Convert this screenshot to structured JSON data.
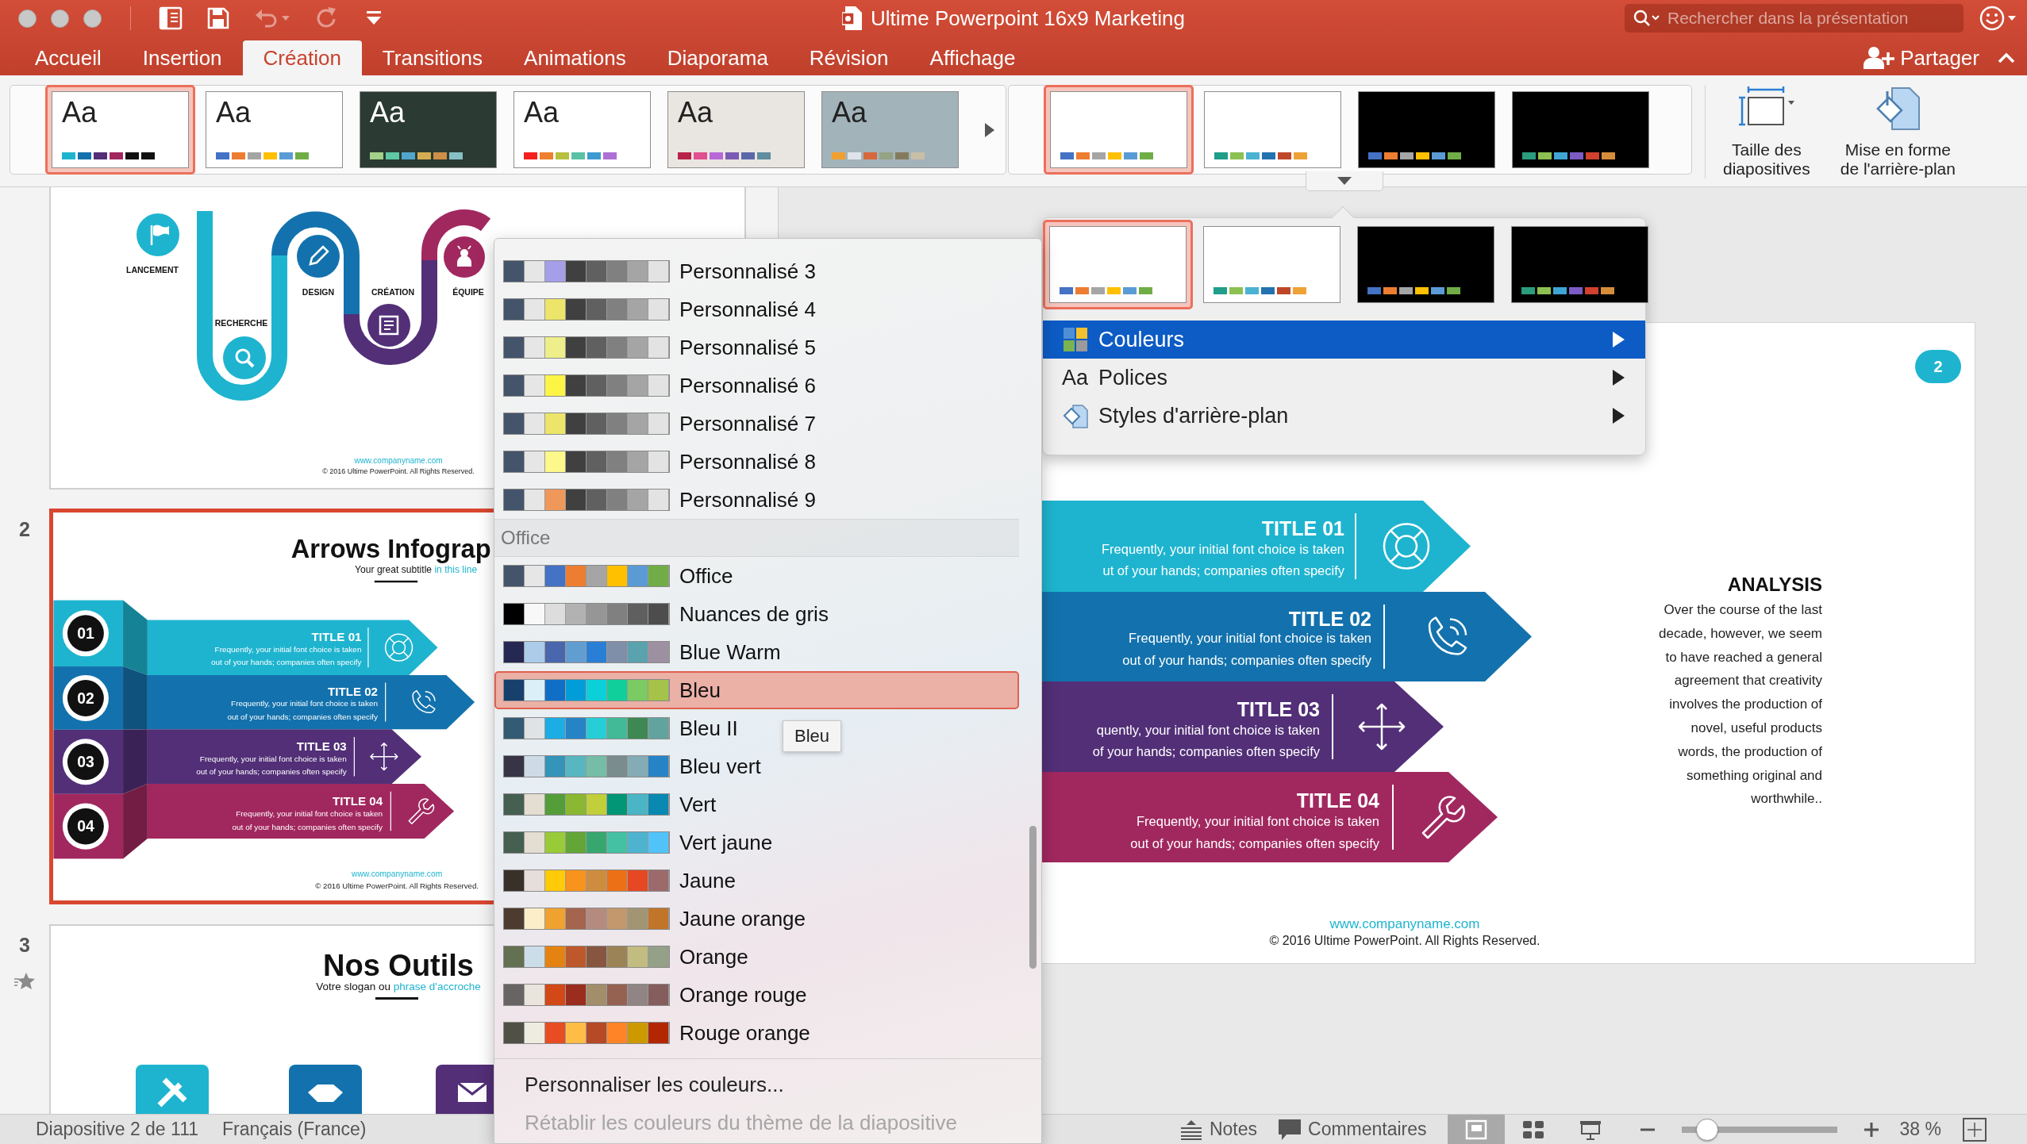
{
  "window": {
    "title": "Ultime Powerpoint 16x9 Marketing"
  },
  "quick_access": [
    {
      "kind": "sidebar",
      "disabled": false
    },
    {
      "kind": "save",
      "disabled": false
    },
    {
      "kind": "undo",
      "disabled": true
    },
    {
      "kind": "redo",
      "disabled": true
    },
    {
      "kind": "customize",
      "disabled": false
    }
  ],
  "search": {
    "placeholder": "Rechercher dans la présentation"
  },
  "tabs": [
    {
      "label": "Accueil",
      "selected": false
    },
    {
      "label": "Insertion",
      "selected": false
    },
    {
      "label": "Création",
      "selected": true
    },
    {
      "label": "Transitions",
      "selected": false
    },
    {
      "label": "Animations",
      "selected": false
    },
    {
      "label": "Diaporama",
      "selected": false
    },
    {
      "label": "Révision",
      "selected": false
    },
    {
      "label": "Affichage",
      "selected": false
    }
  ],
  "share_button": {
    "label": "Partager"
  },
  "ribbon": {
    "themes": [
      {
        "label": "Aa",
        "selected": true,
        "color": "#ffffff",
        "swatches": [
          {
            "color": "#1eb4cf"
          },
          {
            "color": "#1372ad"
          },
          {
            "color": "#522f77"
          },
          {
            "color": "#a1285f"
          },
          {
            "color": "#111111"
          },
          {
            "color": "#111111"
          }
        ]
      },
      {
        "label": "Aa",
        "selected": false,
        "color": "#ffffff",
        "swatches": [
          {
            "color": "#4472c4"
          },
          {
            "color": "#ed7d31"
          },
          {
            "color": "#a5a5a5"
          },
          {
            "color": "#ffc000"
          },
          {
            "color": "#5b9bd5"
          },
          {
            "color": "#70ad47"
          }
        ]
      },
      {
        "label": "Aa",
        "selected": false,
        "color": "#2b3a33",
        "swatches": [
          {
            "color": "#a3d18a"
          },
          {
            "color": "#5ec9a4"
          },
          {
            "color": "#50a7c9"
          },
          {
            "color": "#d4ad52"
          },
          {
            "color": "#cf8f47"
          },
          {
            "color": "#86c0c3"
          }
        ]
      },
      {
        "label": "Aa",
        "selected": false,
        "color": "#ffffff",
        "swatches": [
          {
            "color": "#f4211f"
          },
          {
            "color": "#f07f2e"
          },
          {
            "color": "#b8c03e"
          },
          {
            "color": "#5bc1a5"
          },
          {
            "color": "#3e9bd1"
          },
          {
            "color": "#ae6fd6"
          }
        ]
      },
      {
        "label": "Aa",
        "selected": false,
        "color": "#e9e6e1",
        "swatches": [
          {
            "color": "#b7234a"
          },
          {
            "color": "#e04f8f"
          },
          {
            "color": "#b868d6"
          },
          {
            "color": "#7a5bb3"
          },
          {
            "color": "#5a67a8"
          },
          {
            "color": "#5f8e9e"
          }
        ]
      },
      {
        "label": "Aa",
        "selected": false,
        "color": "#a3b3ba",
        "swatches": [
          {
            "color": "#f0a030"
          },
          {
            "color": "#dfe4ea"
          },
          {
            "color": "#d6683b"
          },
          {
            "color": "#93a383"
          },
          {
            "color": "#857b5c"
          },
          {
            "color": "#c9bfa6"
          }
        ]
      }
    ],
    "variants": [
      {
        "selected": true,
        "color": "#ffffff",
        "swatches": [
          {
            "color": "#4472c4"
          },
          {
            "color": "#ed7d31"
          },
          {
            "color": "#a5a5a5"
          },
          {
            "color": "#ffc000"
          },
          {
            "color": "#5b9bd5"
          },
          {
            "color": "#70ad47"
          }
        ]
      },
      {
        "selected": false,
        "color": "#ffffff",
        "swatches": [
          {
            "color": "#1f9e89"
          },
          {
            "color": "#8cc152"
          },
          {
            "color": "#4ab3d1"
          },
          {
            "color": "#2272b0"
          },
          {
            "color": "#c0462a"
          },
          {
            "color": "#eea236"
          }
        ]
      },
      {
        "selected": false,
        "color": "#000000",
        "swatches": [
          {
            "color": "#4472c4"
          },
          {
            "color": "#ed7d31"
          },
          {
            "color": "#a5a5a5"
          },
          {
            "color": "#ffc000"
          },
          {
            "color": "#5b9bd5"
          },
          {
            "color": "#70ad47"
          }
        ]
      },
      {
        "selected": false,
        "color": "#000000",
        "swatches": [
          {
            "color": "#2a9d7e"
          },
          {
            "color": "#8cc152"
          },
          {
            "color": "#3fa5d4"
          },
          {
            "color": "#7c5cc4"
          },
          {
            "color": "#d0412e"
          },
          {
            "color": "#d58d3a"
          }
        ]
      }
    ],
    "buttons": [
      {
        "kind": "slide-size",
        "lines": [
          "Taille des",
          "diapositives"
        ]
      },
      {
        "kind": "background-format",
        "lines": [
          "Mise en forme",
          "de l'arrière-plan"
        ]
      }
    ]
  },
  "thumbnails": [
    {
      "kind": "road",
      "selected": false,
      "steps": [
        {
          "label": "LANCEMENT",
          "color": "#1eb4cf"
        },
        {
          "label": "RECHERCHE",
          "color": "#1eb4cf"
        },
        {
          "label": "DESIGN",
          "color": "#1372ad"
        },
        {
          "label": "CRÉATION",
          "color": "#522f77"
        },
        {
          "label": "ÉQUIPE",
          "color": "#a1285f"
        }
      ],
      "link": "www.companyname.com",
      "copyright": "© 2016 Ultime PowerPoint. All Rights Reserved."
    },
    {
      "kind": "arrows",
      "number": "2",
      "selected": true,
      "title": "Arrows Infograp",
      "subtitle": "Your great subtitle",
      "subtitle_accent": "in this line",
      "arrows": [
        {
          "number": "01",
          "title": "TITLE 01",
          "lines": [
            "Frequently, your initial font choice is taken",
            "out of your hands; companies often specify"
          ],
          "color": "#1eb4cf"
        },
        {
          "number": "02",
          "title": "TITLE 02",
          "lines": [
            "Frequently, your initial font choice is taken",
            "out of your hands; companies often specify"
          ],
          "color": "#1372ad"
        },
        {
          "number": "03",
          "title": "TITLE 03",
          "lines": [
            "Frequently, your initial font choice is taken",
            "out of your hands; companies often specify"
          ],
          "color": "#522f77"
        },
        {
          "number": "04",
          "title": "TITLE 04",
          "lines": [
            "Frequently, your initial font choice is taken",
            "out of your hands; companies often specify"
          ],
          "color": "#a1285f"
        }
      ],
      "link": "www.companyname.com",
      "copyright": "© 2016 Ultime PowerPoint. All Rights Reserved."
    },
    {
      "kind": "tools",
      "number": "3",
      "selected": false,
      "animated": true,
      "title": "Nos Outils",
      "subtitle": "Votre slogan ou",
      "subtitle_accent": "phrase d'accroche",
      "tiles": [
        {
          "color": "#1eb4cf"
        },
        {
          "color": "#1372ad"
        },
        {
          "color": "#522f77"
        }
      ]
    }
  ],
  "main_slide": {
    "number": "2",
    "arrows": [
      {
        "title": "TITLE 01",
        "lines": [
          "Frequently, your initial font choice is taken",
          "ut of your hands; companies often specify"
        ],
        "color": "#1eb4cf"
      },
      {
        "title": "TITLE 02",
        "lines": [
          "Frequently, your initial font choice is taken",
          "out of your hands; companies often specify"
        ],
        "color": "#1372ad"
      },
      {
        "title": "TITLE 03",
        "lines": [
          "quently, your initial font choice is taken",
          "of your hands; companies often specify"
        ],
        "color": "#522f77"
      },
      {
        "title": "TITLE 04",
        "lines": [
          "Frequently, your initial font choice is taken",
          "out of your hands; companies often specify"
        ],
        "color": "#a1285f"
      }
    ],
    "analysis": {
      "title": "ANALYSIS",
      "lines": [
        "Over the course of the last",
        "decade, however, we seem",
        "to have reached a general",
        "agreement that creativity",
        "involves the production of",
        "novel, useful products",
        "words, the production of",
        "something original and",
        "worthwhile.."
      ]
    },
    "link": "www.companyname.com",
    "copyright": "© 2016 Ultime PowerPoint. All Rights Reserved."
  },
  "design_menu": {
    "variants": [
      {
        "selected": true,
        "color": "#ffffff",
        "swatches": [
          {
            "color": "#4472c4"
          },
          {
            "color": "#ed7d31"
          },
          {
            "color": "#a5a5a5"
          },
          {
            "color": "#ffc000"
          },
          {
            "color": "#5b9bd5"
          },
          {
            "color": "#70ad47"
          }
        ]
      },
      {
        "selected": false,
        "color": "#ffffff",
        "swatches": [
          {
            "color": "#1f9e89"
          },
          {
            "color": "#8cc152"
          },
          {
            "color": "#4ab3d1"
          },
          {
            "color": "#2272b0"
          },
          {
            "color": "#c0462a"
          },
          {
            "color": "#eea236"
          }
        ]
      },
      {
        "selected": false,
        "color": "#000000",
        "swatches": [
          {
            "color": "#4472c4"
          },
          {
            "color": "#ed7d31"
          },
          {
            "color": "#a5a5a5"
          },
          {
            "color": "#ffc000"
          },
          {
            "color": "#5b9bd5"
          },
          {
            "color": "#70ad47"
          }
        ]
      },
      {
        "selected": false,
        "color": "#000000",
        "swatches": [
          {
            "color": "#2a9d7e"
          },
          {
            "color": "#8cc152"
          },
          {
            "color": "#3fa5d4"
          },
          {
            "color": "#7c5cc4"
          },
          {
            "color": "#d0412e"
          },
          {
            "color": "#d58d3a"
          }
        ]
      }
    ],
    "items": [
      {
        "kind": "colors",
        "label": "Couleurs",
        "selected": true
      },
      {
        "kind": "fonts",
        "icon_label": "Aa",
        "label": "Polices",
        "selected": false
      },
      {
        "kind": "background",
        "label": "Styles d'arrière-plan",
        "selected": false
      }
    ]
  },
  "color_menu": {
    "custom_items": [
      {
        "label": "Personnalisé 3",
        "selected": false,
        "swatches": [
          {
            "color": "#44546a"
          },
          {
            "color": "#e7e6e6"
          },
          {
            "color": "#a59ee8"
          },
          {
            "color": "#404040"
          },
          {
            "color": "#606060"
          },
          {
            "color": "#808080"
          },
          {
            "color": "#a5a5a5"
          },
          {
            "color": "#e3e3e3"
          }
        ]
      },
      {
        "label": "Personnalisé 4",
        "selected": false,
        "swatches": [
          {
            "color": "#44546a"
          },
          {
            "color": "#e7e6e6"
          },
          {
            "color": "#ede56a"
          },
          {
            "color": "#404040"
          },
          {
            "color": "#606060"
          },
          {
            "color": "#808080"
          },
          {
            "color": "#a5a5a5"
          },
          {
            "color": "#e3e3e3"
          }
        ]
      },
      {
        "label": "Personnalisé 5",
        "selected": false,
        "swatches": [
          {
            "color": "#44546a"
          },
          {
            "color": "#e7e6e6"
          },
          {
            "color": "#eeee8a"
          },
          {
            "color": "#404040"
          },
          {
            "color": "#606060"
          },
          {
            "color": "#808080"
          },
          {
            "color": "#a5a5a5"
          },
          {
            "color": "#e3e3e3"
          }
        ]
      },
      {
        "label": "Personnalisé 6",
        "selected": false,
        "swatches": [
          {
            "color": "#44546a"
          },
          {
            "color": "#e7e6e6"
          },
          {
            "color": "#fdf545"
          },
          {
            "color": "#404040"
          },
          {
            "color": "#606060"
          },
          {
            "color": "#808080"
          },
          {
            "color": "#a5a5a5"
          },
          {
            "color": "#e3e3e3"
          }
        ]
      },
      {
        "label": "Personnalisé 7",
        "selected": false,
        "swatches": [
          {
            "color": "#44546a"
          },
          {
            "color": "#e7e6e6"
          },
          {
            "color": "#ede56a"
          },
          {
            "color": "#404040"
          },
          {
            "color": "#606060"
          },
          {
            "color": "#808080"
          },
          {
            "color": "#a5a5a5"
          },
          {
            "color": "#e3e3e3"
          }
        ]
      },
      {
        "label": "Personnalisé 8",
        "selected": false,
        "swatches": [
          {
            "color": "#44546a"
          },
          {
            "color": "#e7e6e6"
          },
          {
            "color": "#fdf88a"
          },
          {
            "color": "#404040"
          },
          {
            "color": "#606060"
          },
          {
            "color": "#808080"
          },
          {
            "color": "#a5a5a5"
          },
          {
            "color": "#e3e3e3"
          }
        ]
      },
      {
        "label": "Personnalisé 9",
        "selected": false,
        "swatches": [
          {
            "color": "#44546a"
          },
          {
            "color": "#e7e6e6"
          },
          {
            "color": "#f0985a"
          },
          {
            "color": "#404040"
          },
          {
            "color": "#606060"
          },
          {
            "color": "#808080"
          },
          {
            "color": "#a5a5a5"
          },
          {
            "color": "#e3e3e3"
          }
        ]
      }
    ],
    "section_title": "Office",
    "office_items": [
      {
        "label": "Office",
        "selected": false,
        "swatches": [
          {
            "color": "#44546a"
          },
          {
            "color": "#e7e6e6"
          },
          {
            "color": "#4472c4"
          },
          {
            "color": "#ed7d31"
          },
          {
            "color": "#a5a5a5"
          },
          {
            "color": "#ffc000"
          },
          {
            "color": "#5b9bd5"
          },
          {
            "color": "#70ad47"
          }
        ]
      },
      {
        "label": "Nuances de gris",
        "selected": false,
        "swatches": [
          {
            "color": "#000000"
          },
          {
            "color": "#f8f8f8"
          },
          {
            "color": "#dddddd"
          },
          {
            "color": "#b2b2b2"
          },
          {
            "color": "#969696"
          },
          {
            "color": "#808080"
          },
          {
            "color": "#5f5f5f"
          },
          {
            "color": "#4d4d4d"
          }
        ]
      },
      {
        "label": "Blue Warm",
        "selected": false,
        "swatches": [
          {
            "color": "#242852"
          },
          {
            "color": "#acccea"
          },
          {
            "color": "#4a66ac"
          },
          {
            "color": "#629dd1"
          },
          {
            "color": "#297fd5"
          },
          {
            "color": "#7f8fa9"
          },
          {
            "color": "#5aa2ae"
          },
          {
            "color": "#9d90a0"
          }
        ]
      },
      {
        "label": "Bleu",
        "selected": true,
        "swatches": [
          {
            "color": "#17406d"
          },
          {
            "color": "#dbeff9"
          },
          {
            "color": "#0f6fc6"
          },
          {
            "color": "#009dd9"
          },
          {
            "color": "#0bd0d9"
          },
          {
            "color": "#10cf9b"
          },
          {
            "color": "#7cca62"
          },
          {
            "color": "#a5c249"
          }
        ]
      },
      {
        "label": "Bleu II",
        "selected": false,
        "swatches": [
          {
            "color": "#335b74"
          },
          {
            "color": "#dfe3e5"
          },
          {
            "color": "#1cade4"
          },
          {
            "color": "#2683c6"
          },
          {
            "color": "#27ced7"
          },
          {
            "color": "#42ba97"
          },
          {
            "color": "#3e8853"
          },
          {
            "color": "#62a39f"
          }
        ]
      },
      {
        "label": "Bleu vert",
        "selected": false,
        "swatches": [
          {
            "color": "#373545"
          },
          {
            "color": "#cedbe6"
          },
          {
            "color": "#3494ba"
          },
          {
            "color": "#58b6c0"
          },
          {
            "color": "#75bda7"
          },
          {
            "color": "#7a8c8e"
          },
          {
            "color": "#84acb6"
          },
          {
            "color": "#2683c6"
          }
        ]
      },
      {
        "label": "Vert",
        "selected": false,
        "swatches": [
          {
            "color": "#455f51"
          },
          {
            "color": "#e3ded1"
          },
          {
            "color": "#549e39"
          },
          {
            "color": "#8ab833"
          },
          {
            "color": "#c0cf3a"
          },
          {
            "color": "#029676"
          },
          {
            "color": "#4ab5c4"
          },
          {
            "color": "#0989b1"
          }
        ]
      },
      {
        "label": "Vert jaune",
        "selected": false,
        "swatches": [
          {
            "color": "#455f51"
          },
          {
            "color": "#e3ded1"
          },
          {
            "color": "#99cb38"
          },
          {
            "color": "#63a537"
          },
          {
            "color": "#37a76f"
          },
          {
            "color": "#44c1a3"
          },
          {
            "color": "#4eb3cf"
          },
          {
            "color": "#51c3f9"
          }
        ]
      },
      {
        "label": "Jaune",
        "selected": false,
        "swatches": [
          {
            "color": "#39302a"
          },
          {
            "color": "#e5dedb"
          },
          {
            "color": "#ffca08"
          },
          {
            "color": "#f8931d"
          },
          {
            "color": "#ce8d3e"
          },
          {
            "color": "#ec7016"
          },
          {
            "color": "#e64823"
          },
          {
            "color": "#9c6a6a"
          }
        ]
      },
      {
        "label": "Jaune orange",
        "selected": false,
        "swatches": [
          {
            "color": "#4e3b30"
          },
          {
            "color": "#fbeec9"
          },
          {
            "color": "#f0a22e"
          },
          {
            "color": "#a5644e"
          },
          {
            "color": "#b58b80"
          },
          {
            "color": "#c3986d"
          },
          {
            "color": "#a19574"
          },
          {
            "color": "#c17529"
          }
        ]
      },
      {
        "label": "Orange",
        "selected": false,
        "swatches": [
          {
            "color": "#637052"
          },
          {
            "color": "#ccddea"
          },
          {
            "color": "#e48312"
          },
          {
            "color": "#bd582c"
          },
          {
            "color": "#865640"
          },
          {
            "color": "#9b8357"
          },
          {
            "color": "#c2bc80"
          },
          {
            "color": "#94a088"
          }
        ]
      },
      {
        "label": "Orange rouge",
        "selected": false,
        "swatches": [
          {
            "color": "#696464"
          },
          {
            "color": "#e9e5dc"
          },
          {
            "color": "#d34817"
          },
          {
            "color": "#9b2d1f"
          },
          {
            "color": "#a28e6a"
          },
          {
            "color": "#956251"
          },
          {
            "color": "#918485"
          },
          {
            "color": "#855d5d"
          }
        ]
      },
      {
        "label": "Rouge orange",
        "selected": false,
        "swatches": [
          {
            "color": "#505046"
          },
          {
            "color": "#eeece1"
          },
          {
            "color": "#e84c22"
          },
          {
            "color": "#ffbd47"
          },
          {
            "color": "#b64926"
          },
          {
            "color": "#ff8427"
          },
          {
            "color": "#cc9900"
          },
          {
            "color": "#b22600"
          }
        ]
      }
    ],
    "actions": [
      {
        "label": "Personnaliser les couleurs...",
        "disabled": false
      },
      {
        "label": "Rétablir les couleurs du thème de la diapositive",
        "disabled": true
      }
    ]
  },
  "tooltip": "Bleu",
  "status_bar": {
    "slide_info": "Diapositive 2 de 111",
    "language": "Français (France)",
    "notes": "Notes",
    "comments": "Commentaires",
    "views": [
      {
        "kind": "normal",
        "selected": true
      },
      {
        "kind": "sorter",
        "selected": false
      },
      {
        "kind": "presenter",
        "selected": false
      }
    ],
    "zoom": {
      "level": 0.19,
      "reading": "38 %"
    }
  }
}
